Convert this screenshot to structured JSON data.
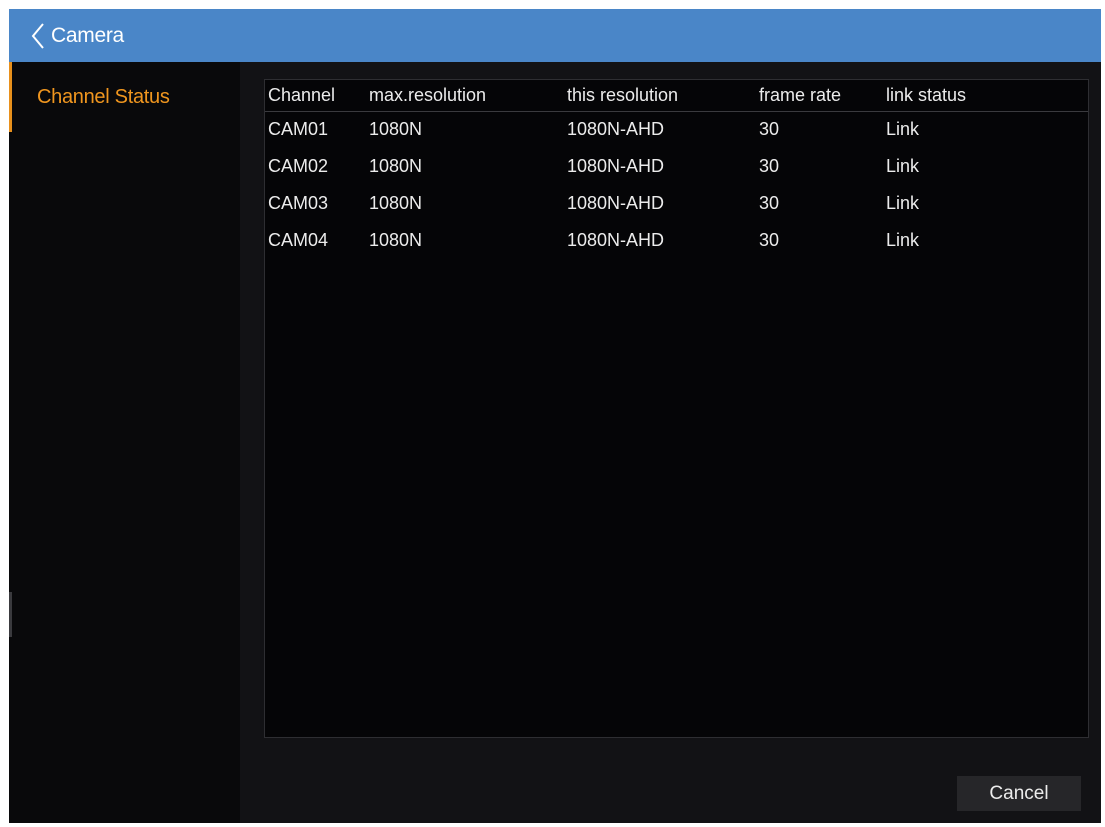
{
  "window": {
    "title": "Camera"
  },
  "sidebar": {
    "items": [
      {
        "label": "Channel Status",
        "active": true
      }
    ]
  },
  "table": {
    "columns": [
      "Channel",
      "max.resolution",
      "this resolution",
      "frame rate",
      "link status"
    ],
    "rows": [
      [
        "CAM01",
        "1080N",
        "1080N-AHD",
        "30",
        "Link"
      ],
      [
        "CAM02",
        "1080N",
        "1080N-AHD",
        "30",
        "Link"
      ],
      [
        "CAM03",
        "1080N",
        "1080N-AHD",
        "30",
        "Link"
      ],
      [
        "CAM04",
        "1080N",
        "1080N-AHD",
        "30",
        "Link"
      ]
    ]
  },
  "footer": {
    "cancel_label": "Cancel"
  },
  "colors": {
    "titlebar": "#4a86c8",
    "accent": "#f0961f",
    "background": "#09090b"
  },
  "icons": {
    "back": "chevron-left-icon"
  }
}
